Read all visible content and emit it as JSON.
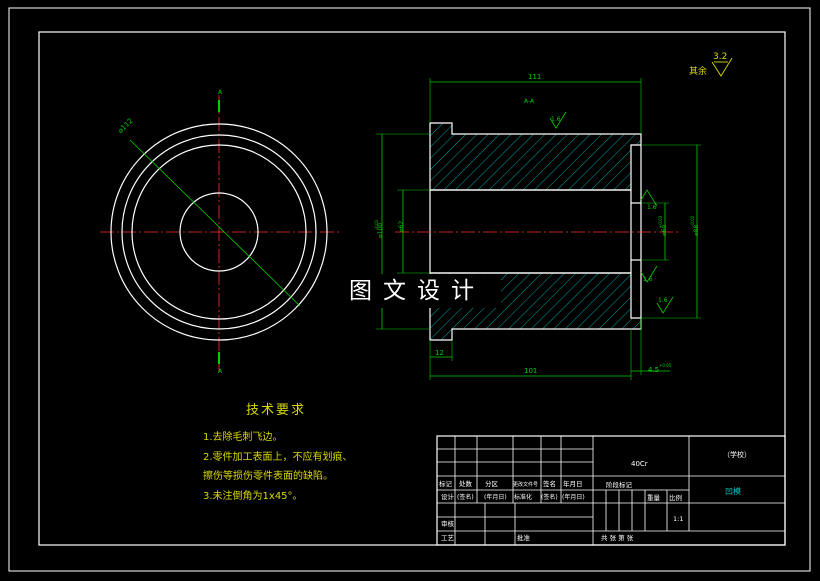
{
  "drawing": {
    "section_label": "A-A",
    "top_marker": "A",
    "bottom_marker": "A",
    "dim_outer_diameter": "⌀112",
    "dim_total_length": "111",
    "dim_body_length": "101",
    "dim_flange_width": "12",
    "dim_right_chamfer": "4.5",
    "dim_right_chamfer_tol": "+0.05",
    "dim_bore": "⌀100",
    "dim_bore_tol": "-0.01",
    "dim_inner": "⌀62",
    "dim_inner_right": "⌀60",
    "dim_inner_right_tol": "+0.03",
    "dim_outer_right": "⌀88",
    "dim_outer_right_tol": "-0.02",
    "roughness_top": "1.6",
    "roughness_mid1": "1.6",
    "roughness_mid2": "1.6",
    "roughness_bottom": "1.6",
    "roughness_general": "3.2",
    "roughness_other_label": "其余"
  },
  "watermark": "图文设计",
  "tech_requirements": {
    "title": "技术要求",
    "line1": "1.去除毛刺飞边。",
    "line2": "2.零件加工表面上，不应有划痕、",
    "line3": "擦伤等损伤零件表面的缺陷。",
    "line4": "3.未注倒角为1x45°。"
  },
  "title_block": {
    "material": "40Cr",
    "school": "（学校）",
    "part_name": "凹模",
    "labels": {
      "mark": "标记",
      "count": "处数",
      "zone": "分区",
      "change_doc": "更改文件号",
      "sign": "签名",
      "date": "年月日",
      "designer": "设计",
      "designer_sign": "(签名)",
      "designer_date": "(年月日)",
      "standard": "标准化",
      "standard_sign": "(签名)",
      "standard_date": "(年月日)",
      "stage_mark": "阶段标记",
      "weight": "重量",
      "scale": "比例",
      "scale_value": "1:1",
      "review": "审核",
      "process": "工艺",
      "approve": "批准",
      "sheets": "共  张  第  张"
    }
  }
}
